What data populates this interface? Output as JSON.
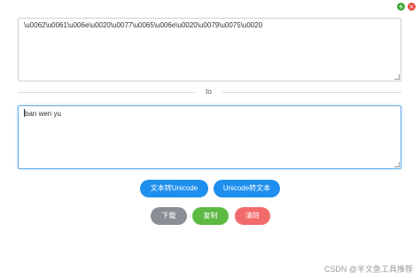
{
  "window_controls": {
    "add_glyph": "+",
    "close_glyph": "×"
  },
  "input": {
    "value": "\\u0062\\u0061\\u006e\\u0020\\u0077\\u0065\\u006e\\u0020\\u0079\\u0075\\u0020"
  },
  "divider": {
    "label": "to"
  },
  "output": {
    "value": "ban wen yu"
  },
  "buttons": {
    "text_to_unicode": "文本转Unicode",
    "unicode_to_text": "Unicode转文本",
    "download": "下载",
    "copy": "复制",
    "clear": "清除"
  },
  "watermark": "CSDN @半文鱼工具推荐",
  "colors": {
    "primary": "#1e8fef",
    "download": "#8a8f96",
    "copy": "#5cb943",
    "clear": "#f26a6a"
  }
}
